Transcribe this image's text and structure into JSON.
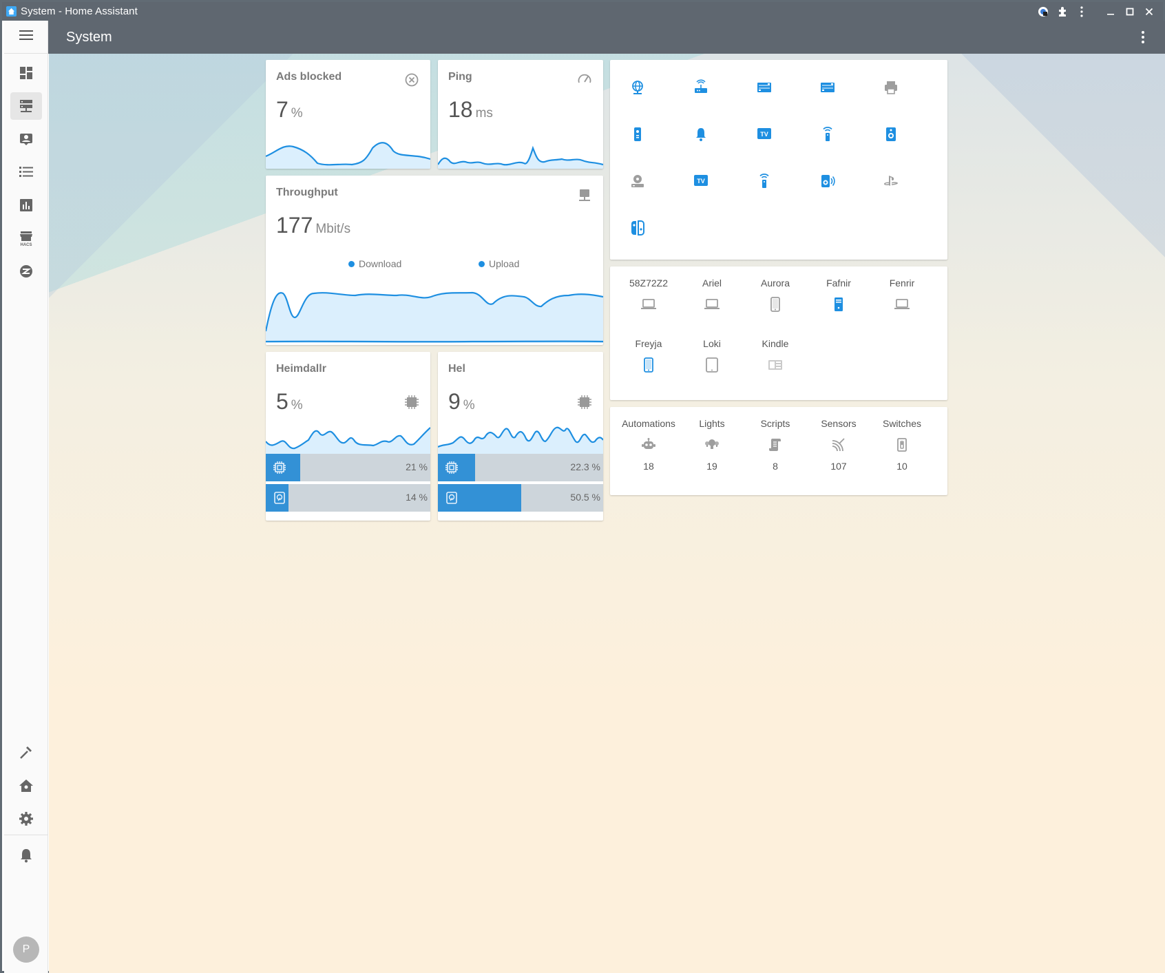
{
  "window": {
    "title": "System - Home Assistant"
  },
  "header": {
    "title": "System"
  },
  "sidebar": {
    "items": [
      "dashboard",
      "system",
      "person",
      "logbook",
      "history",
      "hacs",
      "zwave"
    ],
    "bottom_items": [
      "developer-tools",
      "supervisor",
      "settings",
      "notifications"
    ],
    "avatar_initial": "P"
  },
  "cards": {
    "ads": {
      "title": "Ads blocked",
      "value": "7",
      "unit": "%"
    },
    "ping": {
      "title": "Ping",
      "value": "18",
      "unit": "ms"
    },
    "throughput": {
      "title": "Throughput",
      "value": "177",
      "unit": "Mbit/s",
      "legend": [
        "Download",
        "Upload"
      ]
    },
    "heimdallr": {
      "title": "Heimdallr",
      "value": "5",
      "unit": "%",
      "cpu": "21 %",
      "cpu_fraction": 0.21,
      "disk": "14 %",
      "disk_fraction": 0.14
    },
    "hel": {
      "title": "Hel",
      "value": "9",
      "unit": "%",
      "cpu": "22.3 %",
      "cpu_fraction": 0.223,
      "disk": "50.5 %",
      "disk_fraction": 0.505
    }
  },
  "network_icons": [
    {
      "icon": "globe-icon",
      "active": true
    },
    {
      "icon": "router-icon",
      "active": true
    },
    {
      "icon": "server-icon",
      "active": true
    },
    {
      "icon": "server-icon",
      "active": true
    },
    {
      "icon": "printer-icon",
      "active": false
    },
    {
      "icon": "remote-icon",
      "active": true
    },
    {
      "icon": "bell-icon",
      "active": true
    },
    {
      "icon": "tv-icon",
      "active": true
    },
    {
      "icon": "access-point-icon",
      "active": true
    },
    {
      "icon": "speaker-icon",
      "active": true
    },
    {
      "icon": "nas-icon",
      "active": false
    },
    {
      "icon": "tv-icon",
      "active": true
    },
    {
      "icon": "access-point-icon",
      "active": true
    },
    {
      "icon": "speaker-wireless-icon",
      "active": true
    },
    {
      "icon": "playstation-icon",
      "active": false
    },
    {
      "icon": "nintendo-switch-icon",
      "active": true
    }
  ],
  "devices": [
    {
      "name": "58Z72Z2",
      "icon": "laptop-icon",
      "active": false
    },
    {
      "name": "Ariel",
      "icon": "laptop-icon",
      "active": false
    },
    {
      "name": "Aurora",
      "icon": "cellphone-icon",
      "active": false
    },
    {
      "name": "Fafnir",
      "icon": "desktop-tower-icon",
      "active": true
    },
    {
      "name": "Fenrir",
      "icon": "laptop-icon",
      "active": false
    },
    {
      "name": "Freyja",
      "icon": "cellphone-icon",
      "active": true
    },
    {
      "name": "Loki",
      "icon": "tablet-icon",
      "active": false
    },
    {
      "name": "Kindle",
      "icon": "book-reader-icon",
      "active": false
    }
  ],
  "summary": [
    {
      "name": "Automations",
      "icon": "robot-icon",
      "count": "18"
    },
    {
      "name": "Lights",
      "icon": "lightbulb-group-icon",
      "count": "19"
    },
    {
      "name": "Scripts",
      "icon": "script-icon",
      "count": "8"
    },
    {
      "name": "Sensors",
      "icon": "signal-icon",
      "count": "107"
    },
    {
      "name": "Switches",
      "icon": "switch-icon",
      "count": "10"
    }
  ],
  "colors": {
    "accent": "#1e8fe1",
    "inactive": "#9e9e9e",
    "header": "#5f6770",
    "bar_bg": "#cdd5db",
    "bar_fill": "#3391d6"
  }
}
